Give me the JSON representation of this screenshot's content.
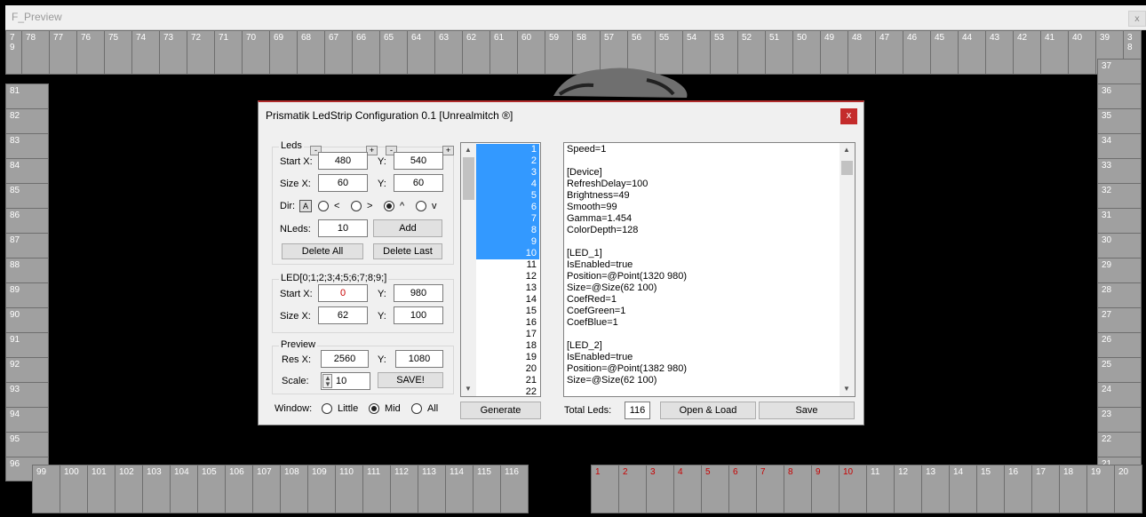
{
  "window": {
    "title": "F_Preview",
    "close_label": "x"
  },
  "leds": {
    "top": [
      "7\n9",
      "78",
      "77",
      "76",
      "75",
      "74",
      "73",
      "72",
      "71",
      "70",
      "69",
      "68",
      "67",
      "66",
      "65",
      "64",
      "63",
      "62",
      "61",
      "60",
      "59",
      "58",
      "57",
      "56",
      "55",
      "54",
      "53",
      "52",
      "51",
      "50",
      "49",
      "48",
      "47",
      "46",
      "45",
      "44",
      "43",
      "42",
      "41",
      "40",
      "39",
      "3\n8"
    ],
    "left": [
      "81",
      "82",
      "83",
      "84",
      "85",
      "86",
      "87",
      "88",
      "89",
      "90",
      "91",
      "92",
      "93",
      "94",
      "95",
      "96"
    ],
    "right": [
      "37",
      "36",
      "35",
      "34",
      "33",
      "32",
      "31",
      "30",
      "29",
      "28",
      "27",
      "26",
      "25",
      "24",
      "23",
      "22",
      "21"
    ],
    "bottom_left": [
      "99",
      "100",
      "101",
      "102",
      "103",
      "104",
      "105",
      "106",
      "107",
      "108",
      "109",
      "110",
      "111",
      "112",
      "113",
      "114",
      "115",
      "116"
    ],
    "bottom_right": [
      "1",
      "2",
      "3",
      "4",
      "5",
      "6",
      "7",
      "8",
      "9",
      "10",
      "11",
      "12",
      "13",
      "14",
      "15",
      "16",
      "17",
      "18",
      "19",
      "20"
    ],
    "highlighted": [
      "1",
      "2",
      "3",
      "4",
      "5",
      "6",
      "7",
      "8",
      "9",
      "10"
    ],
    "highlight_color": "#c80000",
    "led_color": "#a0a0a0"
  },
  "dialog": {
    "title": "Prismatik LedStrip Configuration 0.1 [Unrealmitch ®]",
    "close_label": "x",
    "leds_group": {
      "title": "Leds",
      "minus": "-",
      "plus": "+",
      "start_x_label": "Start X:",
      "start_x": "480",
      "start_y_label": "Y:",
      "start_y": "540",
      "size_x_label": "Size  X:",
      "size_x": "60",
      "size_y_label": "Y:",
      "size_y": "60",
      "dir_label": "Dir:",
      "dir_a": "A",
      "dir_options": [
        "<",
        ">",
        "^",
        "v"
      ],
      "dir_selected": "^",
      "nleds_label": "NLeds:",
      "nleds": "10",
      "add_label": "Add",
      "delete_all_label": "Delete All",
      "delete_last_label": "Delete Last"
    },
    "led_group": {
      "title": "LED[0;1;2;3;4;5;6;7;8;9;]",
      "start_x_label": "Start X:",
      "start_x": "0",
      "start_y_label": "Y:",
      "start_y": "980",
      "size_x_label": "Size X:",
      "size_x": "62",
      "size_y_label": "Y:",
      "size_y": "100"
    },
    "preview_group": {
      "title": "Preview",
      "res_x_label": "Res X:",
      "res_x": "2560",
      "res_y_label": "Y:",
      "res_y": "1080",
      "scale_label": "Scale:",
      "scale": "10",
      "save_label": "SAVE!"
    },
    "window_group": {
      "label": "Window:",
      "options": [
        "Little",
        "Mid",
        "All"
      ],
      "selected": "Mid"
    },
    "list_items": [
      "1",
      "2",
      "3",
      "4",
      "5",
      "6",
      "7",
      "8",
      "9",
      "10",
      "11",
      "12",
      "13",
      "14",
      "15",
      "16",
      "17",
      "18",
      "19",
      "20",
      "21",
      "22"
    ],
    "list_selected": [
      "1",
      "2",
      "3",
      "4",
      "5",
      "6",
      "7",
      "8",
      "9",
      "10"
    ],
    "generate_label": "Generate",
    "config_lines": [
      "Speed=1",
      "",
      "[Device]",
      "RefreshDelay=100",
      "Brightness=49",
      "Smooth=99",
      "Gamma=1.454",
      "ColorDepth=128",
      "",
      "[LED_1]",
      "IsEnabled=true",
      "Position=@Point(1320 980)",
      "Size=@Size(62 100)",
      "CoefRed=1",
      "CoefGreen=1",
      "CoefBlue=1",
      "",
      "[LED_2]",
      "IsEnabled=true",
      "Position=@Point(1382 980)",
      "Size=@Size(62 100)"
    ],
    "total_leds_label": "Total Leds:",
    "total_leds": "116",
    "open_load_label": "Open & Load",
    "save_label": "Save",
    "accent_color": "#3399ff",
    "start_x_value_color": "#c80000"
  }
}
